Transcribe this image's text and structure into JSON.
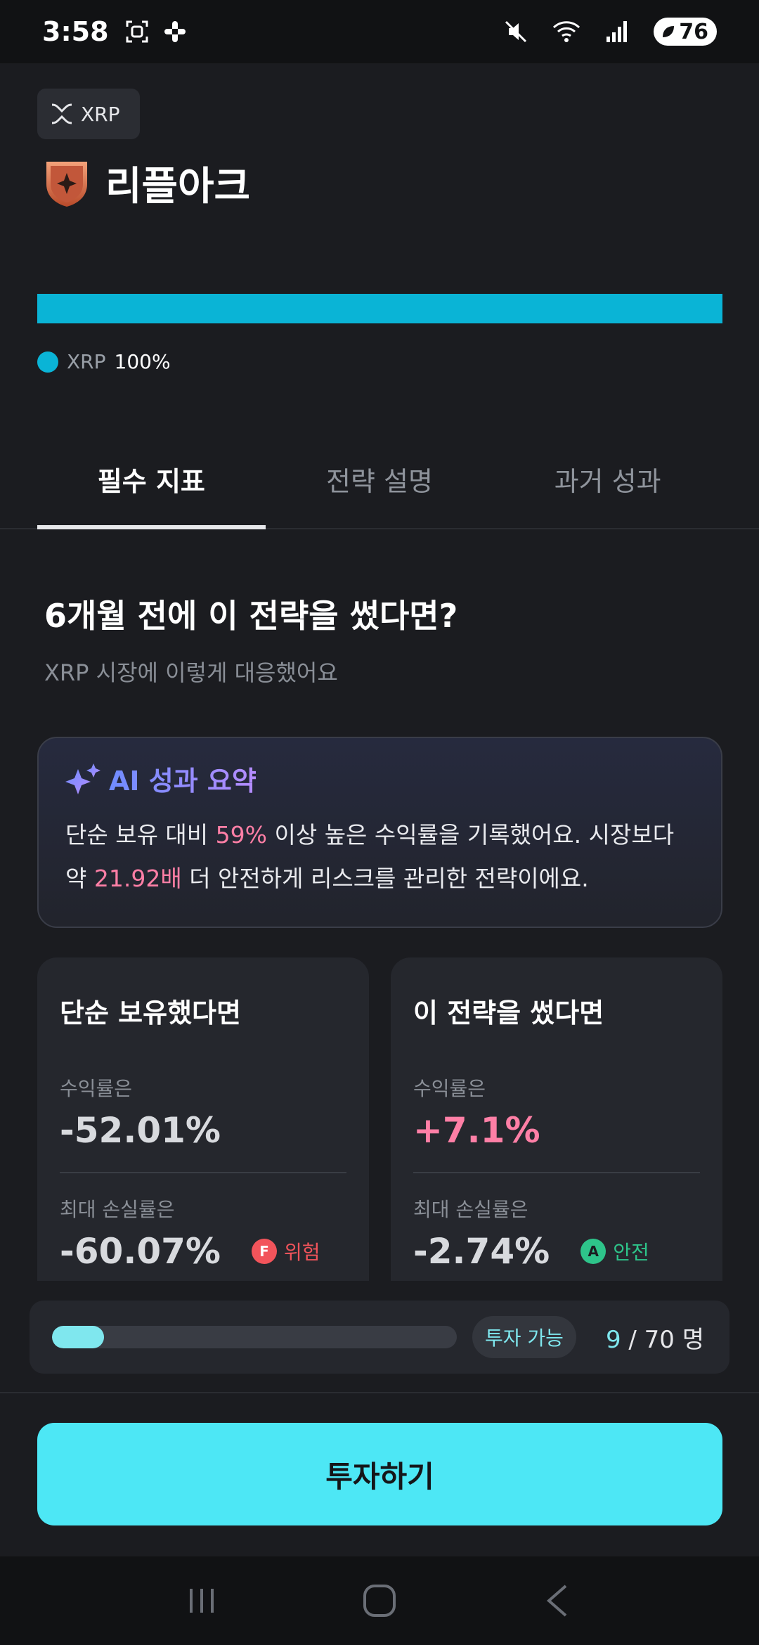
{
  "status_bar": {
    "time": "3:58",
    "battery": "76"
  },
  "asset": {
    "chip_label": "XRP"
  },
  "strategy": {
    "title": "리플아크"
  },
  "allocation": {
    "name": "XRP",
    "percent": "100%",
    "fraction": 1.0,
    "color": "#0ab4d6"
  },
  "tabs": [
    "필수 지표",
    "전략 설명",
    "과거 성과"
  ],
  "section": {
    "title": "6개월 전에 이 전략을 썼다면?",
    "subtitle": "XRP 시장에 이렇게 대응했어요"
  },
  "ai_summary": {
    "label": "AI 성과 요약",
    "text_1": "단순 보유 대비 ",
    "hl_1": "59%",
    "text_2": " 이상 높은 수익률을 기록했어요. 시장보다 약 ",
    "hl_2": "21.92배",
    "text_3": " 더 안전하게 리스크를 관리한 전략이에요."
  },
  "hold_card": {
    "title": "단순 보유했다면",
    "return_label": "수익률은",
    "return_value": "-52.01%",
    "mdd_label": "최대 손실률은",
    "mdd_value": "-60.07%",
    "grade": "F",
    "grade_text": "위험"
  },
  "strategy_card": {
    "title": "이 전략을 썼다면",
    "return_label": "수익률은",
    "return_value": "+7.1%",
    "mdd_label": "최대 손실률은",
    "mdd_value": "-2.74%",
    "grade": "A",
    "grade_text": "안전"
  },
  "capacity": {
    "status": "투자 가능",
    "current": "9",
    "separator": " / ",
    "total": "70 명",
    "fill_fraction": 0.1286
  },
  "cta": {
    "label": "투자하기"
  }
}
